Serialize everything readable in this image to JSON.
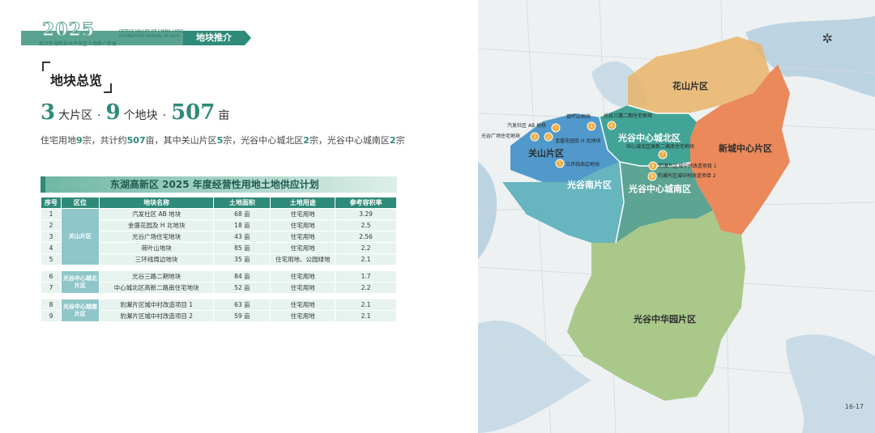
{
  "header": {
    "year": "2025",
    "brand_en": "OPTICS VALLEY OF CHINA LAND PROMOTION MANUAL IN 2025",
    "brand_cn": "武汉东湖新技术开发区土地推介手册",
    "section": "地块推介"
  },
  "page_title": "地块总览",
  "stats": {
    "districts": "3",
    "districts_unit": "大片区",
    "plots": "9",
    "plots_unit": "个地块",
    "area": "507",
    "area_unit": "亩",
    "separator": "·"
  },
  "summary": {
    "p1": "住宅用地",
    "n1": "9",
    "p2": "宗，共计约",
    "n2": "507",
    "p3": "亩，其中关山片区",
    "n3": "5",
    "p4": "宗，光谷中心城北区",
    "n4": "2",
    "p5": "宗，光谷中心城南区",
    "n5": "2",
    "p6": "宗"
  },
  "table": {
    "title": "东湖高新区 2025 年度经营性用地土地供应计划",
    "headers": [
      "序号",
      "区位",
      "地块名称",
      "土地面积",
      "土地用途",
      "参考容积率"
    ],
    "groups": [
      {
        "district": "关山片区",
        "rows": [
          {
            "no": "1",
            "name": "汽发社区 AB 地块",
            "area": "68 亩",
            "use": "住宅用地",
            "far": "3.29"
          },
          {
            "no": "2",
            "name": "金盛花园及 H 北地块",
            "area": "18 亩",
            "use": "住宅用地",
            "far": "2.5"
          },
          {
            "no": "3",
            "name": "光谷广场住宅地块",
            "area": "43 亩",
            "use": "住宅用地",
            "far": "2.56"
          },
          {
            "no": "4",
            "name": "荷叶山地块",
            "area": "85 亩",
            "use": "住宅用地",
            "far": "2.2"
          },
          {
            "no": "5",
            "name": "三环线周边地块",
            "area": "35 亩",
            "use": "住宅用地、公园绿地",
            "far": "2.1"
          }
        ]
      },
      {
        "district": "光谷中心城北片区",
        "rows": [
          {
            "no": "6",
            "name": "光谷三路二期地块",
            "area": "84 亩",
            "use": "住宅用地",
            "far": "1.7"
          },
          {
            "no": "7",
            "name": "中心城北区高新二路南住宅地块",
            "area": "52 亩",
            "use": "住宅用地",
            "far": "2.2"
          }
        ]
      },
      {
        "district": "光谷中心城南片区",
        "rows": [
          {
            "no": "8",
            "name": "豹澥片区城中村改造项目 1",
            "area": "63 亩",
            "use": "住宅用地",
            "far": "2.1"
          },
          {
            "no": "9",
            "name": "豹澥片区城中村改造项目 2",
            "area": "59 亩",
            "use": "住宅用地",
            "far": "2.1"
          }
        ]
      }
    ]
  },
  "map": {
    "districts": [
      {
        "name": "花山片区",
        "color": "#e9b468"
      },
      {
        "name": "新城中心片区",
        "color": "#ea7d4a"
      },
      {
        "name": "光谷中心城北区",
        "color": "#2f9b8c"
      },
      {
        "name": "关山片区",
        "color": "#3f8fc7"
      },
      {
        "name": "光谷南片区",
        "color": "#57aeb9"
      },
      {
        "name": "光谷中心城南区",
        "color": "#4c9b87"
      },
      {
        "name": "光谷中华园片区",
        "color": "#a2c37e"
      }
    ],
    "plots": [
      {
        "no": "1",
        "label": "汽发社区 AB 地块"
      },
      {
        "no": "2",
        "label": "金盛花园及 H 北地块"
      },
      {
        "no": "3",
        "label": "光谷广场住宅地块"
      },
      {
        "no": "4",
        "label": "荷叶山地块"
      },
      {
        "no": "5",
        "label": "三环线周边地块"
      },
      {
        "no": "6",
        "label": "光谷三路二期住宅地块"
      },
      {
        "no": "7",
        "label": "中心城北区高新二路南住宅地块"
      },
      {
        "no": "8",
        "label": "豹澥片区城中村改造项目 1"
      },
      {
        "no": "9",
        "label": "豹澥片区城中村改造项目 2"
      }
    ],
    "marker_color": "#f1a93b",
    "water_color": "#bcd3e2"
  },
  "page_number": "16-17"
}
